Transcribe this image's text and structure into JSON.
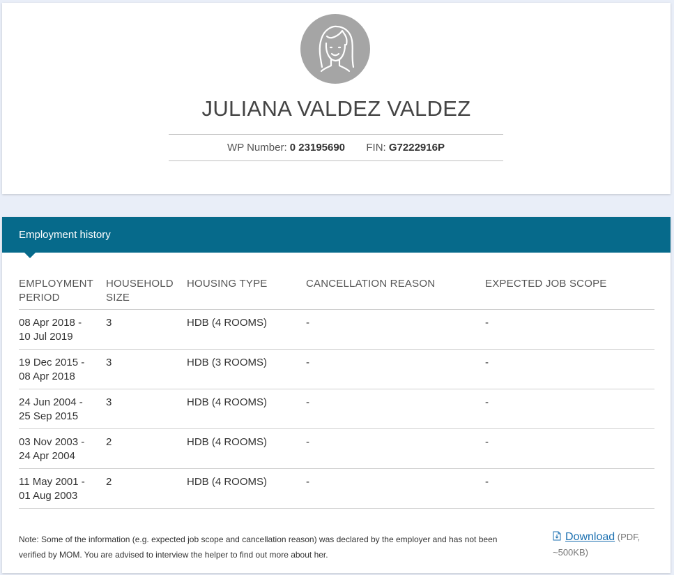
{
  "profile": {
    "name": "JULIANA VALDEZ VALDEZ",
    "wp_label": "WP Number:",
    "wp_value": "0 23195690",
    "fin_label": "FIN:",
    "fin_value": "G7222916P",
    "avatar_icon": "female-avatar-icon"
  },
  "history": {
    "title": "Employment history",
    "header_color": "#066a8b",
    "columns": [
      {
        "line1": "EMPLOYMENT",
        "line2": "PERIOD"
      },
      {
        "line1": "HOUSEHOLD",
        "line2": "SIZE"
      },
      {
        "line1": "HOUSING TYPE",
        "line2": ""
      },
      {
        "line1": "CANCELLATION REASON",
        "line2": ""
      },
      {
        "line1": "EXPECTED JOB SCOPE",
        "line2": ""
      }
    ],
    "rows": [
      {
        "period1": "08 Apr 2018 -",
        "period2": "10 Jul 2019",
        "size": "3",
        "housing": "HDB (4 ROOMS)",
        "cancel": "-",
        "scope": "-"
      },
      {
        "period1": "19 Dec 2015 -",
        "period2": "08 Apr 2018",
        "size": "3",
        "housing": "HDB (3 ROOMS)",
        "cancel": "-",
        "scope": "-"
      },
      {
        "period1": "24 Jun 2004 -",
        "period2": "25 Sep 2015",
        "size": "3",
        "housing": "HDB (4 ROOMS)",
        "cancel": "-",
        "scope": "-"
      },
      {
        "period1": "03 Nov 2003 -",
        "period2": "24 Apr 2004",
        "size": "2",
        "housing": "HDB (4 ROOMS)",
        "cancel": "-",
        "scope": "-"
      },
      {
        "period1": "11 May 2001 -",
        "period2": "01 Aug 2003",
        "size": "2",
        "housing": "HDB (4 ROOMS)",
        "cancel": "-",
        "scope": "-"
      }
    ]
  },
  "footer": {
    "note_line1": "Note: Some of the information (e.g. expected job scope and cancellation reason) was declared by the employer and has not been",
    "note_line2": "verified by MOM. You are advised to interview the helper to find out more about her.",
    "download_label": "Download",
    "download_meta1": " (PDF,",
    "download_meta2": "~500KB)",
    "download_icon": "file-download-icon",
    "link_color": "#1a6fb0"
  }
}
